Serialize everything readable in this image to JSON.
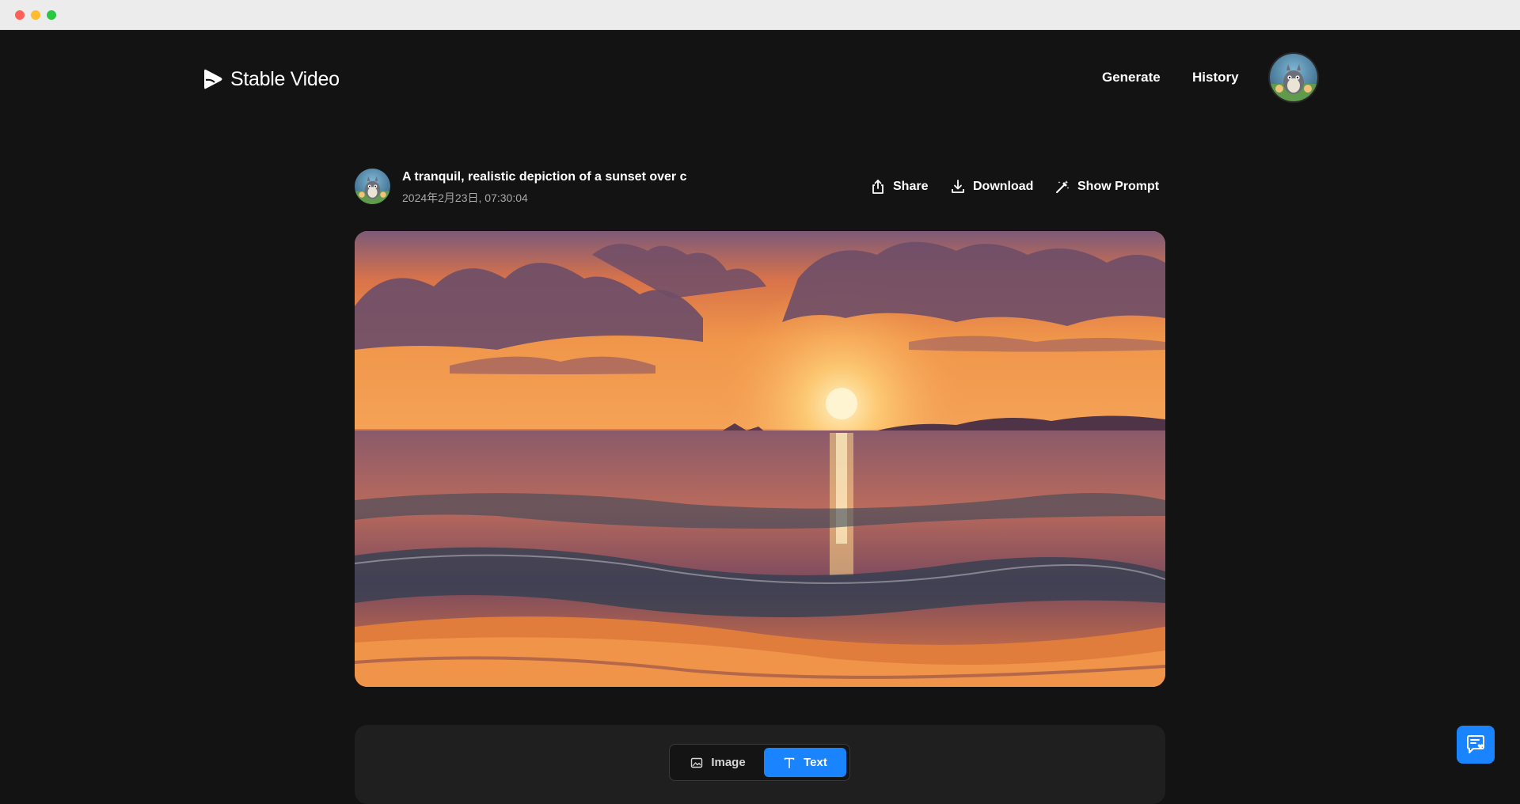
{
  "window": {
    "controls": [
      "close",
      "minimize",
      "maximize"
    ]
  },
  "header": {
    "brand": "Stable Video",
    "nav": {
      "generate": "Generate",
      "history": "History"
    },
    "avatar_icon": "user-avatar"
  },
  "video": {
    "title": "A tranquil, realistic depiction of a sunset over c",
    "date": "2024年2月23日, 07:30:04",
    "actions": {
      "share": "Share",
      "download": "Download",
      "show_prompt": "Show Prompt"
    },
    "preview_icon": "sunset-over-ocean-image"
  },
  "mode_toggle": {
    "image_label": "Image",
    "text_label": "Text",
    "selected": "Text"
  },
  "colors": {
    "background": "#131313",
    "accent": "#1a84ff",
    "panel": "#1f1f1f"
  },
  "feedback_icon": "feedback-chat-icon"
}
